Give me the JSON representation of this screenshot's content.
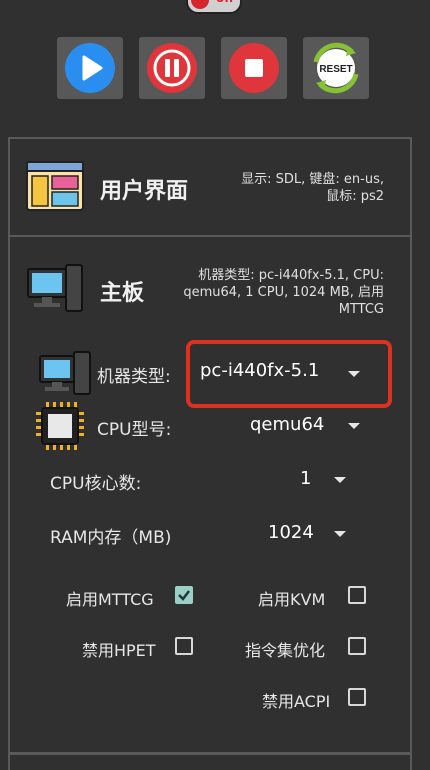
{
  "power_toggle": {
    "label": "off"
  },
  "controls": [
    {
      "name": "play",
      "color": "#2a8ef0"
    },
    {
      "name": "pause",
      "color": "#e0353b"
    },
    {
      "name": "stop",
      "color": "#e0353b"
    },
    {
      "name": "reset",
      "label": "RESET",
      "color": "#86c233"
    }
  ],
  "ui_panel": {
    "title": "用户界面",
    "desc_line1": "显示: SDL, 键盘: en-us,",
    "desc_line2": "鼠标: ps2"
  },
  "board_panel": {
    "title": "主板",
    "desc_line1": "机器类型:  pc-i440fx-5.1, CPU:",
    "desc_line2": "qemu64, 1 CPU, 1024 MB, 启用",
    "desc_line3": "MTTCG",
    "machine_type": {
      "label": "机器类型:",
      "value": "pc-i440fx-5.1"
    },
    "cpu_model": {
      "label": "CPU型号:",
      "value": "qemu64"
    },
    "cpu_cores": {
      "label": "CPU核心数:",
      "value": "1"
    },
    "ram": {
      "label": "RAM内存（MB)",
      "value": "1024"
    },
    "options": {
      "mttcg": {
        "label": "启用MTTCG",
        "checked": true
      },
      "kvm": {
        "label": "启用KVM",
        "checked": false
      },
      "hpet": {
        "label": "禁用HPET",
        "checked": false
      },
      "insn_opt": {
        "label": "指令集优化",
        "checked": false
      },
      "acpi": {
        "label": "禁用ACPI",
        "checked": false
      }
    }
  },
  "colors": {
    "background": "#303030",
    "panel_border": "#5a5a5a",
    "highlight": "#e0301e",
    "checkbox_on": "#9ad0c8"
  }
}
